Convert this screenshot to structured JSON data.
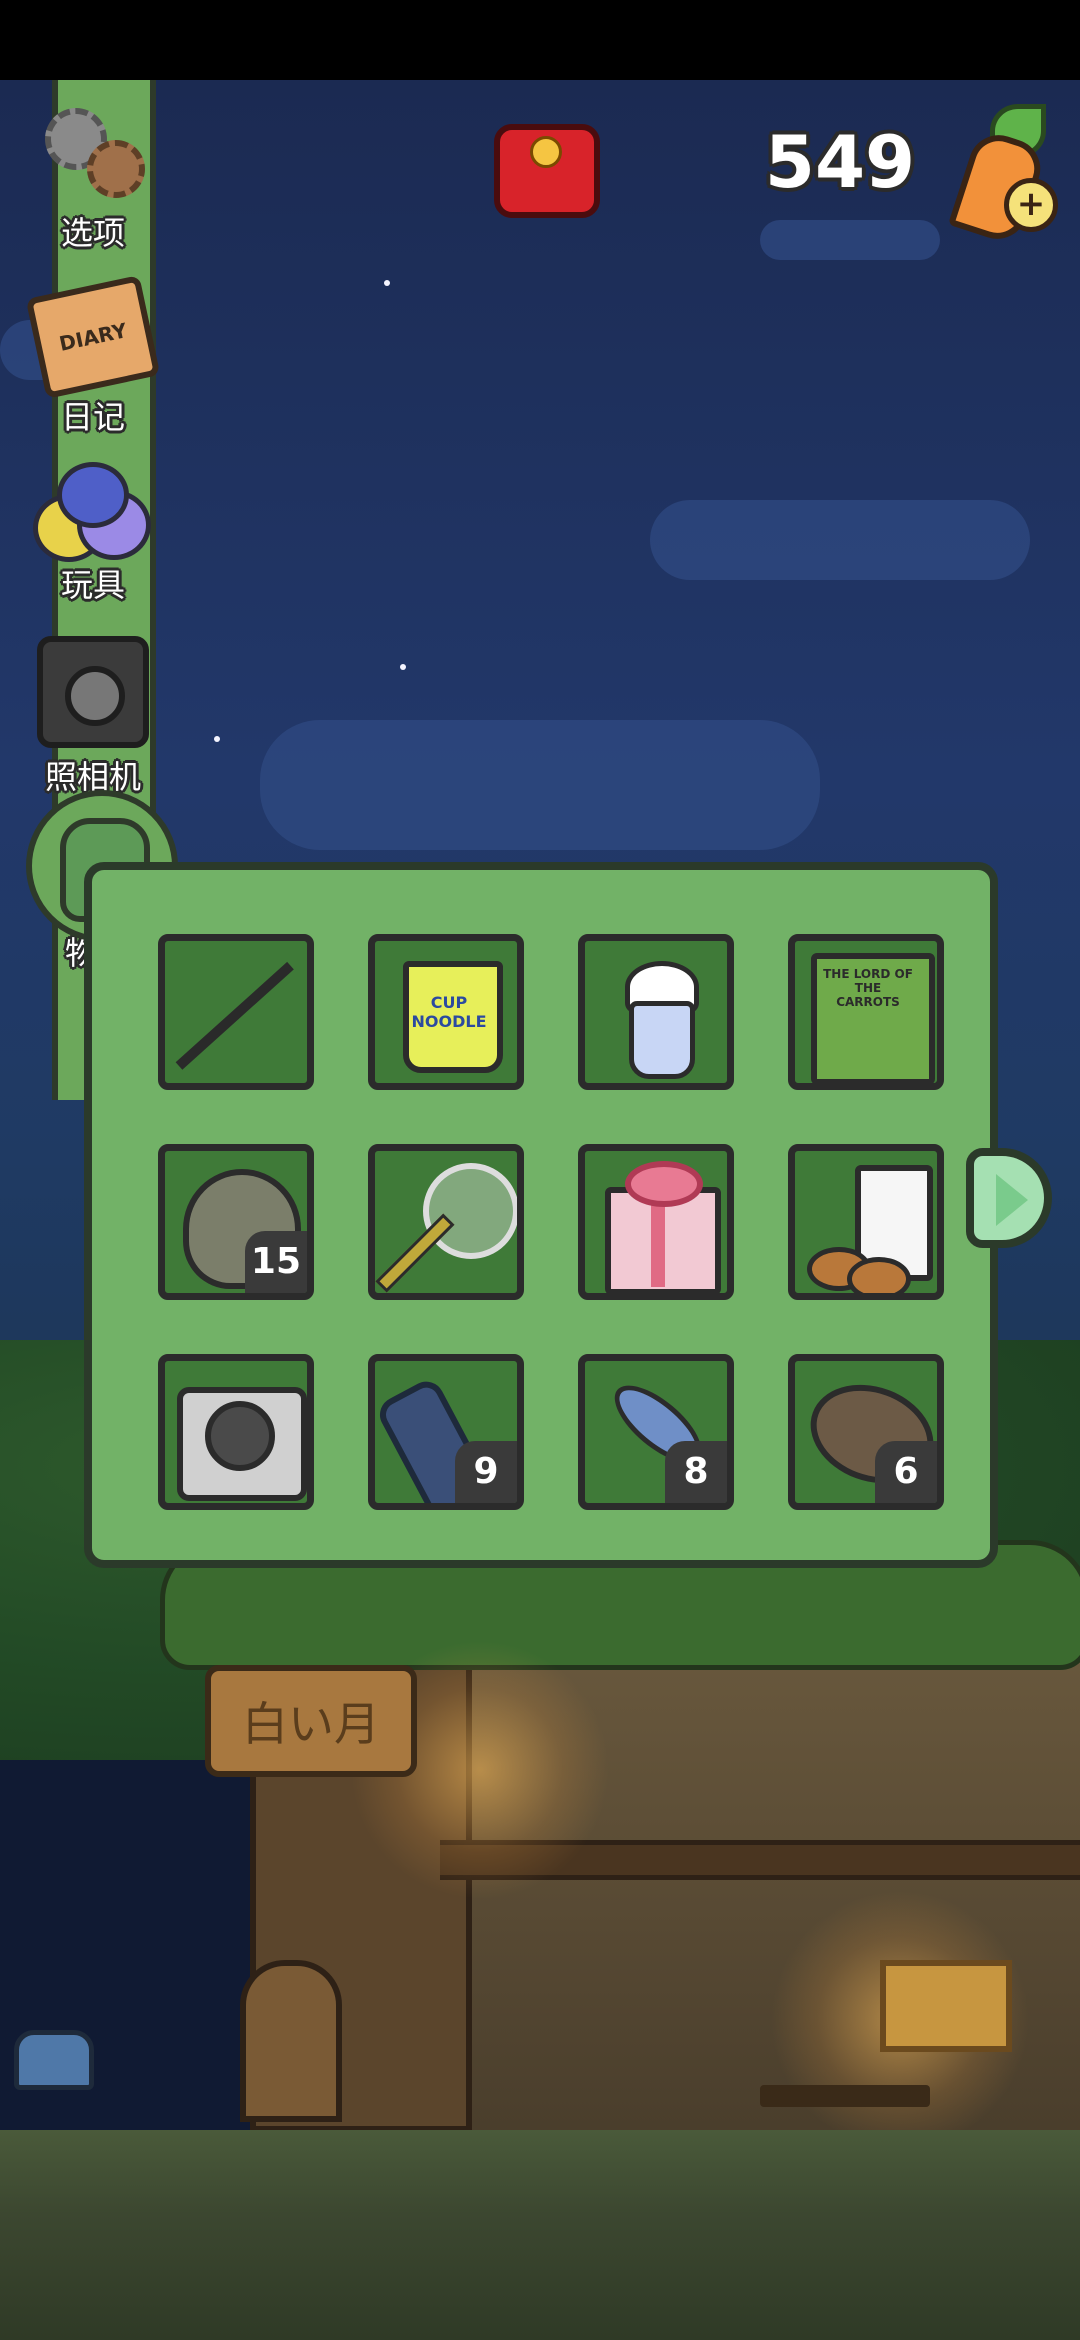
{
  "hud": {
    "carrot_count": "549",
    "red_packet_icon": "red-packet-icon",
    "carrot_add_icon": "carrot-plus-icon"
  },
  "sidebar": {
    "items": [
      {
        "label": "选项",
        "icon": "gear-icon"
      },
      {
        "label": "日记",
        "icon": "diary-icon",
        "icon_text": "DIARY"
      },
      {
        "label": "玩具",
        "icon": "toys-icon"
      },
      {
        "label": "照相机",
        "icon": "camera-icon"
      },
      {
        "label": "物品",
        "icon": "backpack-icon"
      }
    ]
  },
  "scene": {
    "sign_text": "白い月"
  },
  "inventory": {
    "slots": [
      {
        "name": "fishing-rod",
        "count": ""
      },
      {
        "name": "cup-noodle",
        "count": "",
        "label": "CUP NOODLE"
      },
      {
        "name": "milkshake",
        "count": ""
      },
      {
        "name": "book",
        "count": "",
        "label": "THE LORD OF THE CARROTS"
      },
      {
        "name": "seed-sack",
        "count": "15"
      },
      {
        "name": "bug-net",
        "count": ""
      },
      {
        "name": "gift-box",
        "count": ""
      },
      {
        "name": "milk-and-cookies",
        "count": ""
      },
      {
        "name": "instant-camera",
        "count": ""
      },
      {
        "name": "plastic-bottle",
        "count": "9"
      },
      {
        "name": "fish",
        "count": "8"
      },
      {
        "name": "flatfish",
        "count": "6"
      }
    ]
  },
  "colors": {
    "panel": "#72b267",
    "slot": "#3f7a38",
    "outline": "#2b2b2b"
  }
}
